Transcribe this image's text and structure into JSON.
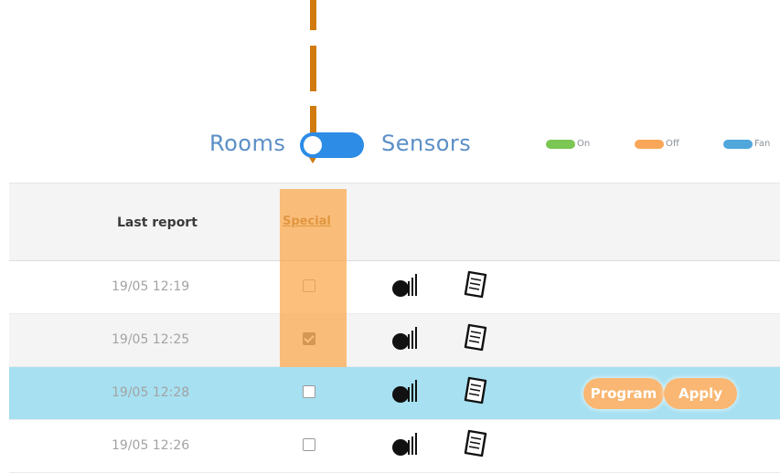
{
  "toggle": {
    "left_label": "Rooms",
    "right_label": "Sensors"
  },
  "legend": [
    {
      "label": "On",
      "color": "#7cc653"
    },
    {
      "label": "Off",
      "color": "#f9a659"
    },
    {
      "label": "Fan",
      "color": "#4fa7dc"
    }
  ],
  "table": {
    "headers": {
      "last_report": "Last report",
      "special": "Special"
    },
    "rows": [
      {
        "last_report": "19/05 12:19",
        "special_checked": false,
        "selected": false
      },
      {
        "last_report": "19/05 12:25",
        "special_checked": true,
        "selected": false
      },
      {
        "last_report": "19/05 12:28",
        "special_checked": false,
        "selected": true
      },
      {
        "last_report": "19/05 12:26",
        "special_checked": false,
        "selected": false
      }
    ]
  },
  "actions": {
    "program_label": "Program",
    "apply_label": "Apply"
  },
  "icons": {
    "row_chart": "chart-icon",
    "row_book": "notebook-icon"
  },
  "colors": {
    "accent_blue": "#2d8ce6",
    "highlight_orange": "#fca84a",
    "selected_row": "#a6e0f1",
    "arrow": "#d07a10"
  }
}
